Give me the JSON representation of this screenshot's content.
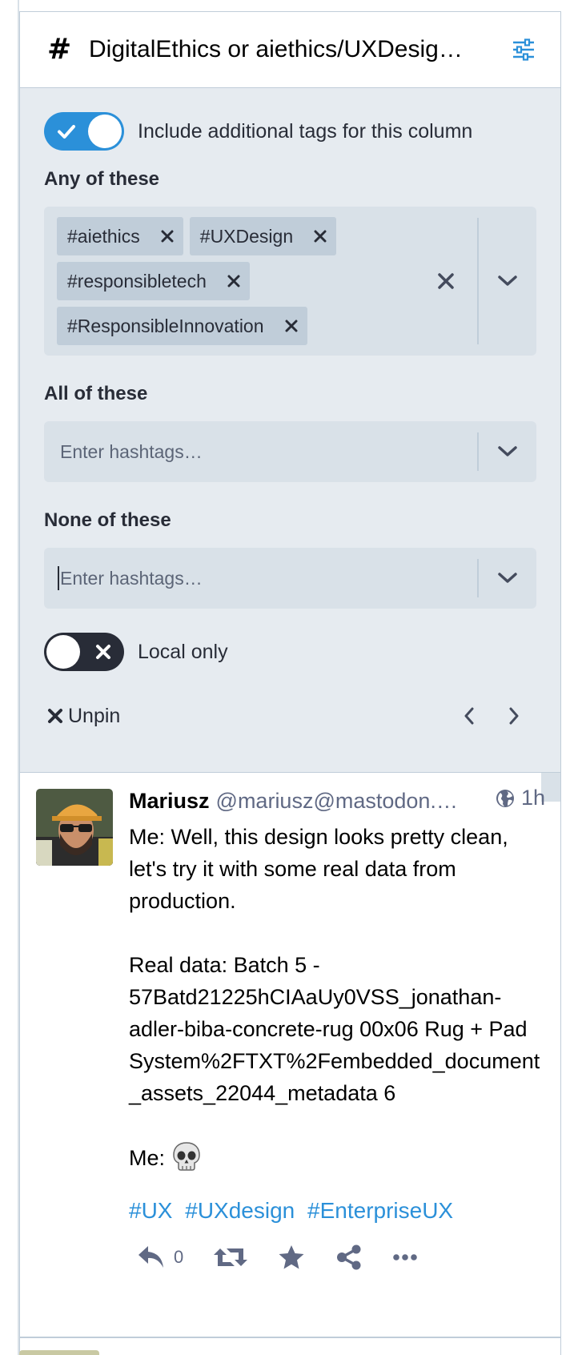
{
  "column": {
    "title": "DigitalEthics or aiethics/UXDesig…",
    "icons": {
      "title": "hashtag-icon",
      "settings": "sliders-icon"
    }
  },
  "settings": {
    "additional_tags": {
      "label": "Include additional tags for this column",
      "enabled": true
    },
    "any_of": {
      "label": "Any of these",
      "tags": [
        "#aiethics",
        "#UXDesign",
        "#responsibletech",
        "#ResponsibleInnovation"
      ]
    },
    "all_of": {
      "label": "All of these",
      "placeholder": "Enter hashtags…"
    },
    "none_of": {
      "label": "None of these",
      "placeholder": "Enter hashtags…"
    },
    "local_only": {
      "label": "Local only",
      "enabled": false
    },
    "unpin_label": "Unpin"
  },
  "status": {
    "display_name": "Mariusz",
    "acct": "@mariusz@mastodon.…",
    "time": "1h",
    "paragraphs": [
      "Me: Well, this design looks pretty clean, let's try it with some real data from production.",
      "Real data: Batch 5 - 57Batd21225hCIAaUy0VSS_jonathan-adler-biba-concrete-rug 00x06 Rug + Pad System%2FTXT%2Fembedded_document_assets_22044_metadata 6"
    ],
    "last_prefix": "Me: ",
    "hashtags": [
      "#UX",
      "#UXdesign",
      "#EnterpriseUX"
    ],
    "reply_count": "0"
  },
  "colors": {
    "accent": "#2b90d9",
    "panel_bg": "#e6ebf0",
    "chip_bg": "#c0cdd9",
    "text": "#282c37",
    "muted": "#606984"
  }
}
